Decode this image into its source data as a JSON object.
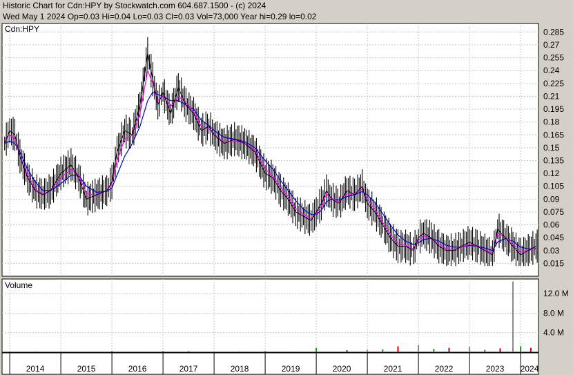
{
  "header": {
    "line1": "Historic Chart for Cdn:HPY by Stockwatch.com 604.687.1500 - (c) 2024",
    "line2": "Wed May  1 2024  Op=0.03 Hi=0.04  Lo=0.03  Cl=0.03  Vol=73,000  Year hi=0.29  lo=0.02"
  },
  "colors": {
    "background": "#d4d0c8",
    "panel": "#ffffff",
    "grid": "#c8c8c8",
    "price_bars": "#000000",
    "down_marks": "#cc0000",
    "ma_short": "#ff00ff",
    "ma_long": "#0000cc",
    "volume_bars": "#888888",
    "volume_green": "#00aa00",
    "volume_red": "#cc0000"
  },
  "chart_data": [
    {
      "type": "line",
      "title": "Cdn:HPY",
      "ylim": [
        0.0,
        0.295
      ],
      "yticks": [
        0.015,
        0.03,
        0.045,
        0.06,
        0.075,
        0.09,
        0.105,
        0.12,
        0.135,
        0.15,
        0.165,
        0.18,
        0.195,
        0.21,
        0.225,
        0.24,
        0.255,
        0.27,
        0.285
      ],
      "ytick_labels": [
        "0.015",
        "0.03",
        "0.045",
        "0.06",
        "0.075",
        "0.09",
        "0.105",
        "0.12",
        "0.135",
        "0.15",
        "0.165",
        "0.18",
        "0.195",
        "0.21",
        "0.225",
        "0.24",
        "0.255",
        "0.27",
        "0.285"
      ],
      "xlim": [
        2013.85,
        2024.35
      ],
      "x": [
        2013.9,
        2014.0,
        2014.1,
        2014.2,
        2014.35,
        2014.5,
        2014.65,
        2014.8,
        2015.0,
        2015.2,
        2015.35,
        2015.5,
        2015.7,
        2015.9,
        2016.0,
        2016.1,
        2016.25,
        2016.4,
        2016.55,
        2016.7,
        2016.8,
        2016.9,
        2017.0,
        2017.15,
        2017.3,
        2017.45,
        2017.6,
        2017.75,
        2017.9,
        2018.0,
        2018.2,
        2018.4,
        2018.6,
        2018.8,
        2019.0,
        2019.15,
        2019.3,
        2019.45,
        2019.6,
        2019.75,
        2019.9,
        2020.0,
        2020.1,
        2020.2,
        2020.3,
        2020.45,
        2020.6,
        2020.75,
        2020.9,
        2021.0,
        2021.15,
        2021.3,
        2021.45,
        2021.6,
        2021.75,
        2021.9,
        2022.0,
        2022.1,
        2022.25,
        2022.4,
        2022.55,
        2022.7,
        2022.85,
        2023.0,
        2023.15,
        2023.3,
        2023.45,
        2023.55,
        2023.7,
        2023.85,
        2024.0,
        2024.15,
        2024.3
      ],
      "series": [
        {
          "values": [
            0.155,
            0.17,
            0.165,
            0.14,
            0.115,
            0.1,
            0.095,
            0.1,
            0.12,
            0.13,
            0.115,
            0.09,
            0.095,
            0.1,
            0.11,
            0.145,
            0.17,
            0.165,
            0.2,
            0.26,
            0.23,
            0.2,
            0.215,
            0.19,
            0.22,
            0.2,
            0.19,
            0.17,
            0.175,
            0.165,
            0.155,
            0.16,
            0.155,
            0.145,
            0.12,
            0.115,
            0.1,
            0.09,
            0.075,
            0.07,
            0.065,
            0.075,
            0.085,
            0.1,
            0.09,
            0.085,
            0.1,
            0.095,
            0.105,
            0.085,
            0.075,
            0.06,
            0.045,
            0.035,
            0.035,
            0.03,
            0.045,
            0.05,
            0.045,
            0.035,
            0.03,
            0.03,
            0.035,
            0.04,
            0.035,
            0.03,
            0.025,
            0.055,
            0.045,
            0.035,
            0.025,
            0.03,
            0.035
          ],
          "style": "price-bars"
        },
        {
          "values": [
            0.16,
            0.165,
            0.16,
            0.14,
            0.118,
            0.102,
            0.096,
            0.1,
            0.115,
            0.125,
            0.118,
            0.097,
            0.094,
            0.1,
            0.108,
            0.135,
            0.16,
            0.165,
            0.19,
            0.24,
            0.225,
            0.205,
            0.21,
            0.198,
            0.21,
            0.203,
            0.192,
            0.175,
            0.172,
            0.165,
            0.157,
            0.158,
            0.155,
            0.147,
            0.125,
            0.117,
            0.104,
            0.093,
            0.079,
            0.072,
            0.067,
            0.073,
            0.082,
            0.096,
            0.091,
            0.087,
            0.097,
            0.096,
            0.102,
            0.09,
            0.078,
            0.063,
            0.049,
            0.038,
            0.036,
            0.032,
            0.042,
            0.047,
            0.045,
            0.037,
            0.032,
            0.031,
            0.034,
            0.038,
            0.035,
            0.031,
            0.027,
            0.05,
            0.046,
            0.037,
            0.028,
            0.03,
            0.033
          ],
          "style": "ma-short"
        },
        {
          "values": [
            0.155,
            0.158,
            0.155,
            0.145,
            0.125,
            0.11,
            0.1,
            0.1,
            0.108,
            0.118,
            0.118,
            0.105,
            0.098,
            0.099,
            0.103,
            0.118,
            0.14,
            0.155,
            0.175,
            0.205,
            0.215,
            0.212,
            0.21,
            0.205,
            0.205,
            0.2,
            0.195,
            0.182,
            0.176,
            0.17,
            0.162,
            0.16,
            0.157,
            0.15,
            0.135,
            0.125,
            0.112,
            0.1,
            0.088,
            0.078,
            0.072,
            0.072,
            0.077,
            0.087,
            0.09,
            0.089,
            0.093,
            0.095,
            0.099,
            0.095,
            0.086,
            0.073,
            0.06,
            0.048,
            0.041,
            0.037,
            0.039,
            0.043,
            0.044,
            0.041,
            0.036,
            0.034,
            0.034,
            0.036,
            0.035,
            0.033,
            0.03,
            0.04,
            0.044,
            0.041,
            0.034,
            0.032,
            0.032
          ],
          "style": "ma-long"
        }
      ]
    },
    {
      "type": "bar",
      "title": "Volume",
      "ylim": [
        0,
        15000000
      ],
      "yticks": [
        4000000,
        8000000,
        12000000
      ],
      "ytick_labels": [
        "4.0 M",
        "8.0 M",
        "12.0 M"
      ],
      "xlim": [
        2013.85,
        2024.35
      ],
      "x": [
        2014.0,
        2014.5,
        2015.0,
        2015.5,
        2016.0,
        2016.5,
        2017.0,
        2017.5,
        2018.0,
        2018.5,
        2019.0,
        2019.5,
        2020.0,
        2020.6,
        2021.0,
        2021.3,
        2021.6,
        2022.0,
        2022.3,
        2022.6,
        2023.0,
        2023.3,
        2023.6,
        2023.85,
        2024.0,
        2024.2
      ],
      "values": [
        150000,
        120000,
        180000,
        100000,
        200000,
        150000,
        250000,
        200000,
        180000,
        150000,
        200000,
        180000,
        900000,
        400000,
        500000,
        600000,
        1200000,
        1500000,
        700000,
        900000,
        1100000,
        500000,
        800000,
        14500000,
        1200000,
        900000
      ]
    }
  ],
  "xaxis": {
    "year_labels": [
      "2014",
      "2015",
      "2016",
      "2017",
      "2018",
      "2019",
      "2020",
      "2021",
      "2022",
      "2023",
      "2024"
    ]
  }
}
